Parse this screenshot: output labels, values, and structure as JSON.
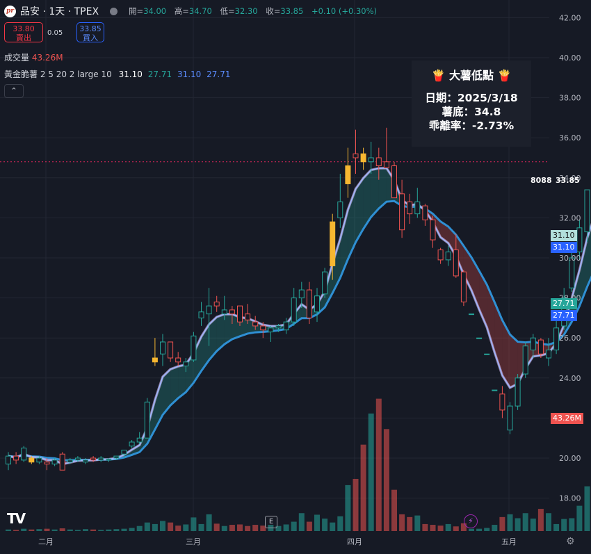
{
  "header": {
    "logo_text": "pr",
    "symbol": "品安 · 1天 · TPEX",
    "ohlc": [
      {
        "k": "開=",
        "v": "34.00"
      },
      {
        "k": "高=",
        "v": "34.70"
      },
      {
        "k": "低=",
        "v": "32.30"
      },
      {
        "k": "收=",
        "v": "33.85"
      }
    ],
    "change": "+0.10 (+0.30%)"
  },
  "trade": {
    "sell_price": "33.80",
    "sell_label": "賣出",
    "spread": "0.05",
    "buy_price": "33.85",
    "buy_label": "買入"
  },
  "volume_legend": {
    "label": "成交量",
    "value": "43.26M"
  },
  "indicator": {
    "name": "黃金脆薯 2 5 20 2 large 10",
    "values": [
      "31.10",
      "27.71",
      "31.10",
      "27.71"
    ]
  },
  "collapse_icon": "chevron-up-icon",
  "info_box": {
    "title": "大薯低點",
    "icon": "fries-icon",
    "date_line": "日期：2025/3/18",
    "bottom_line": "薯底：34.8",
    "deviation_line": "乖離率：-2.73%"
  },
  "price_labels": {
    "code": "8088",
    "last": "33.85",
    "fast_a": "31.10",
    "fast_b": "31.10",
    "slow_a": "27.71",
    "slow_b": "27.71",
    "volume": "43.26M"
  },
  "colors": {
    "up": "#26a69a",
    "down": "#ef5350",
    "highlight": "#f7b731",
    "fast_line": "#9fb8ff",
    "slow_line": "#2f8fd3"
  },
  "badges": {
    "earnings": "E",
    "logo": "TV",
    "gear_icon": "gear-icon",
    "zap_icon": "lightning-icon"
  },
  "chart_data": {
    "type": "candlestick",
    "y_axis_ticks": [
      "42.00",
      "40.00",
      "38.00",
      "36.00",
      "34.00",
      "32.00",
      "30.00",
      "28.00",
      "26.00",
      "24.00",
      "22.00",
      "20.00",
      "18.00"
    ],
    "x_axis_ticks": [
      "二月",
      "三月",
      "四月",
      "五月"
    ],
    "reference_line": 34.8,
    "candles": [
      [
        19.7,
        20.3,
        19.4,
        20.1,
        0.4
      ],
      [
        20.1,
        20.3,
        19.7,
        19.9,
        0.3
      ],
      [
        19.9,
        20.6,
        19.8,
        20.5,
        0.6
      ],
      [
        20.0,
        20.1,
        19.7,
        19.8,
        0.4
      ],
      [
        19.8,
        20.1,
        19.7,
        20.0,
        0.5
      ],
      [
        19.8,
        20.0,
        19.4,
        19.7,
        0.6
      ],
      [
        19.7,
        20.0,
        19.6,
        19.9,
        0.4
      ],
      [
        20.2,
        20.3,
        19.4,
        19.4,
        0.7
      ],
      [
        19.8,
        20.0,
        19.7,
        19.9,
        0.4
      ],
      [
        19.9,
        20.1,
        19.8,
        20.0,
        0.3
      ],
      [
        19.8,
        20.0,
        19.7,
        19.9,
        0.5
      ],
      [
        20.0,
        20.1,
        19.8,
        19.9,
        0.4
      ],
      [
        19.9,
        20.1,
        19.8,
        20.0,
        0.3
      ],
      [
        19.9,
        20.0,
        19.8,
        19.95,
        0.4
      ],
      [
        20.0,
        20.1,
        19.9,
        20.1,
        0.5
      ],
      [
        20.2,
        20.4,
        20.0,
        20.4,
        0.6
      ],
      [
        20.6,
        20.9,
        20.5,
        20.8,
        0.8
      ],
      [
        20.8,
        21.3,
        20.7,
        21.0,
        1.3
      ],
      [
        21.0,
        23.0,
        21.0,
        22.8,
        2.2
      ],
      [
        24.8,
        26.0,
        24.6,
        25.0,
        1.8
      ],
      [
        25.2,
        26.2,
        24.6,
        25.8,
        2.6
      ],
      [
        25.8,
        25.8,
        24.8,
        25.0,
        2.2
      ],
      [
        25.0,
        25.3,
        24.6,
        24.8,
        1.4
      ],
      [
        24.6,
        25.0,
        24.3,
        24.8,
        1.7
      ],
      [
        24.9,
        26.3,
        24.8,
        26.1,
        3.5
      ],
      [
        27.0,
        27.8,
        26.6,
        27.3,
        1.8
      ],
      [
        27.2,
        28.5,
        25.6,
        27.6,
        4.3
      ],
      [
        27.8,
        28.1,
        27.3,
        27.6,
        1.9
      ],
      [
        27.2,
        28.1,
        26.9,
        27.4,
        1.3
      ],
      [
        27.4,
        27.6,
        26.7,
        27.2,
        1.6
      ],
      [
        27.6,
        27.6,
        26.6,
        26.8,
        1.7
      ],
      [
        27.2,
        27.7,
        26.7,
        26.9,
        1.3
      ],
      [
        26.8,
        27.1,
        26.4,
        26.6,
        1.6
      ],
      [
        26.6,
        26.8,
        26.0,
        26.4,
        1.4
      ],
      [
        26.3,
        26.6,
        25.8,
        26.5,
        1.6
      ],
      [
        26.5,
        26.7,
        26.3,
        26.6,
        1.3
      ],
      [
        26.4,
        27.0,
        26.2,
        26.8,
        1.7
      ],
      [
        26.8,
        28.5,
        26.6,
        28.0,
        2.4
      ],
      [
        28.0,
        28.8,
        27.5,
        28.4,
        4.6
      ],
      [
        28.4,
        28.8,
        26.7,
        27.0,
        2.4
      ],
      [
        27.3,
        28.5,
        26.8,
        28.1,
        4.2
      ],
      [
        28.2,
        29.5,
        28.0,
        29.3,
        3.2
      ],
      [
        29.6,
        32.2,
        28.9,
        31.8,
        2.2
      ],
      [
        32.0,
        34.2,
        31.5,
        32.8,
        3.8
      ],
      [
        33.7,
        35.5,
        33.0,
        34.6,
        11.8
      ],
      [
        35.2,
        36.4,
        34.2,
        35.0,
        13.4
      ],
      [
        35.2,
        35.5,
        34.4,
        34.8,
        22.2
      ],
      [
        34.8,
        35.8,
        34.2,
        35.0,
        30.2
      ],
      [
        35.0,
        35.5,
        33.9,
        34.6,
        34.0
      ],
      [
        34.8,
        36.5,
        34.5,
        34.5,
        26.2
      ],
      [
        34.6,
        34.8,
        33.0,
        33.0,
        10.6
      ],
      [
        33.2,
        33.9,
        31.0,
        31.4,
        4.3
      ],
      [
        32.8,
        33.2,
        31.7,
        32.2,
        3.6
      ],
      [
        32.2,
        33.5,
        32.0,
        32.8,
        4.0
      ],
      [
        32.6,
        32.7,
        31.6,
        31.9,
        1.8
      ],
      [
        31.9,
        32.1,
        30.5,
        30.9,
        1.6
      ],
      [
        30.4,
        30.5,
        29.7,
        29.9,
        1.4
      ],
      [
        29.9,
        30.6,
        29.6,
        30.3,
        1.8
      ],
      [
        30.4,
        31.2,
        29.0,
        29.1,
        1.2
      ],
      [
        29.3,
        29.4,
        27.6,
        27.8,
        2.0
      ],
      [
        27.2,
        27.2,
        27.2,
        27.2,
        0.6
      ],
      [
        26.0,
        26.0,
        26.0,
        26.0,
        0.6
      ],
      [
        25.2,
        25.2,
        25.2,
        25.2,
        0.8
      ],
      [
        23.4,
        23.4,
        23.4,
        23.4,
        1.6
      ],
      [
        23.2,
        23.6,
        22.0,
        22.4,
        3.6
      ],
      [
        21.4,
        22.8,
        21.2,
        22.6,
        4.3
      ],
      [
        22.6,
        24.2,
        22.4,
        24.0,
        3.3
      ],
      [
        24.2,
        25.8,
        24.0,
        25.6,
        4.6
      ],
      [
        25.4,
        26.2,
        25.0,
        26.0,
        3.2
      ],
      [
        25.9,
        26.0,
        25.0,
        25.2,
        5.7
      ],
      [
        25.0,
        26.0,
        24.6,
        25.4,
        4.6
      ],
      [
        25.4,
        27.0,
        25.2,
        26.5,
        1.8
      ],
      [
        26.6,
        28.5,
        26.4,
        28.0,
        3.1
      ],
      [
        28.5,
        30.8,
        28.3,
        30.0,
        3.3
      ],
      [
        30.3,
        31.9,
        29.9,
        31.5,
        6.5
      ],
      [
        31.3,
        33.0,
        30.8,
        33.4,
        11.5
      ],
      [
        34.0,
        34.7,
        32.3,
        33.85,
        17.2
      ]
    ]
  }
}
